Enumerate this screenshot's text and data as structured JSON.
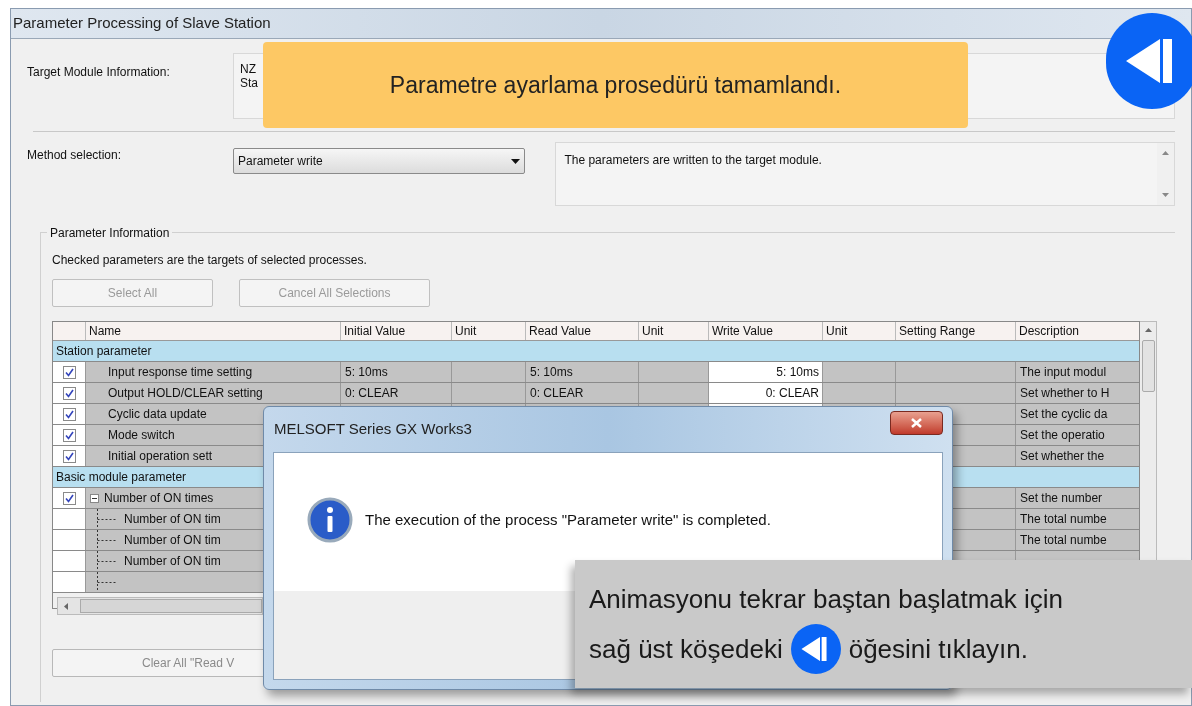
{
  "window": {
    "title": "Parameter Processing of Slave Station"
  },
  "target_module": {
    "label": "Target Module Information:",
    "lines": [
      "NZ",
      "Sta"
    ]
  },
  "method": {
    "label": "Method selection:",
    "value": "Parameter write",
    "description": "The parameters are written to the target module."
  },
  "parameter_information": {
    "legend": "Parameter Information",
    "note": "Checked parameters are the targets of selected processes.",
    "buttons": [
      {
        "label": "Select All",
        "disabled": true
      },
      {
        "label": "Cancel All Selections",
        "disabled": true
      }
    ]
  },
  "table": {
    "columns": [
      "Name",
      "Initial Value",
      "Unit",
      "Read Value",
      "Unit",
      "Write Value",
      "Unit",
      "Setting Range",
      "Description"
    ],
    "groups": [
      {
        "title": "Station parameter",
        "rows": [
          {
            "checked": true,
            "name": "Input response time setting",
            "initial_value": "5: 10ms",
            "read_value": "5: 10ms",
            "write_value": "5: 10ms",
            "description": "The input modul"
          },
          {
            "checked": true,
            "name": "Output HOLD/CLEAR setting",
            "initial_value": "0: CLEAR",
            "read_value": "0: CLEAR",
            "write_value": "0: CLEAR",
            "description": "Set whether to H"
          },
          {
            "checked": true,
            "name": "Cyclic data update",
            "description": "Set the cyclic da"
          },
          {
            "checked": true,
            "name": "Mode switch",
            "description": "Set the operatio"
          },
          {
            "checked": true,
            "name": "Initial operation sett",
            "description": "Set whether the"
          }
        ]
      },
      {
        "title": "Basic module parameter",
        "rows": [
          {
            "checked": true,
            "expanded": true,
            "name": "Number of ON times",
            "description": "Set the number",
            "children": [
              {
                "name": "Number of ON tim",
                "description": "The total numbe"
              },
              {
                "name": "Number of ON tim",
                "description": "The total numbe"
              },
              {
                "name": "Number of ON tim"
              }
            ]
          }
        ]
      }
    ]
  },
  "clear_button": {
    "label": "Clear All \"Read V"
  },
  "dialog": {
    "title": "MELSOFT Series GX Works3",
    "message": "The execution of the process \"Parameter write\" is completed."
  },
  "banner": {
    "text": "Parametre ayarlama prosedürü tamamlandı."
  },
  "hint": {
    "line_1": "Animasyonu tekrar baştan başlatmak için",
    "line_2_before": "sağ üst köşedeki",
    "line_2_after": "öğesini tıklayın."
  }
}
